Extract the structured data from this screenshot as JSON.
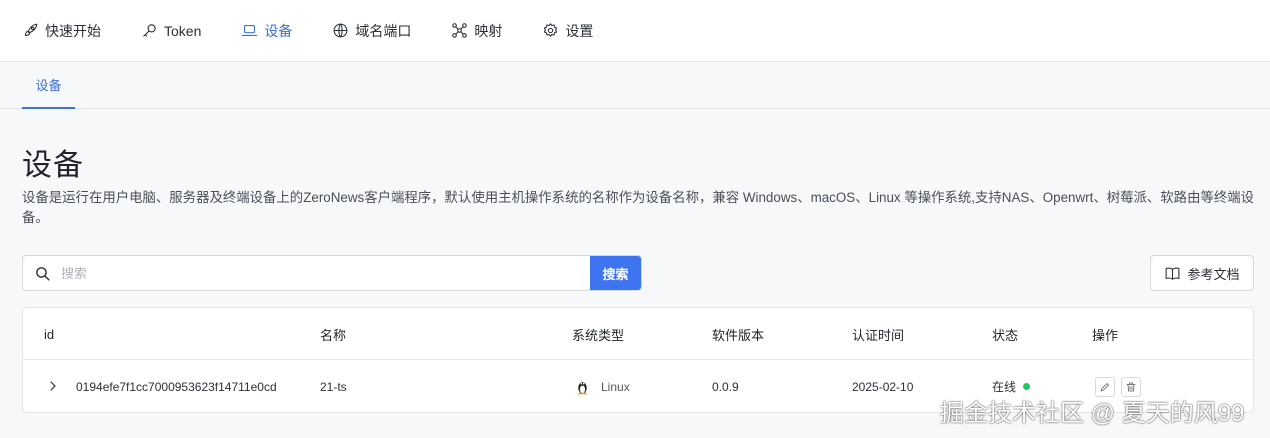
{
  "nav": {
    "items": [
      {
        "label": "快速开始",
        "icon": "rocket-icon"
      },
      {
        "label": "Token",
        "icon": "key-icon"
      },
      {
        "label": "设备",
        "icon": "laptop-icon",
        "active": true
      },
      {
        "label": "域名端口",
        "icon": "globe-icon"
      },
      {
        "label": "映射",
        "icon": "network-icon"
      },
      {
        "label": "设置",
        "icon": "gear-icon"
      }
    ]
  },
  "subtabs": {
    "active": "设备"
  },
  "page": {
    "title": "设备",
    "description": "设备是运行在用户电脑、服务器及终端设备上的ZeroNews客户端程序，默认使用主机操作系统的名称作为设备名称，兼容 Windows、macOS、Linux 等操作系统,支持NAS、Openwrt、树莓派、软路由等终端设备。"
  },
  "search": {
    "placeholder": "搜索",
    "value": "",
    "button_label": "搜索"
  },
  "docs_button": {
    "label": "参考文档",
    "icon": "book-icon"
  },
  "table": {
    "columns": [
      "id",
      "名称",
      "系统类型",
      "软件版本",
      "认证时间",
      "状态",
      "操作"
    ],
    "rows": [
      {
        "id": "0194efe7f1cc7000953623f14711e0cd",
        "name": "21-ts",
        "os": "Linux",
        "version": "0.0.9",
        "auth_time": "2025-02-10",
        "status": "在线"
      }
    ]
  },
  "colors": {
    "accent": "#3b71d8",
    "search_button": "#3f74f0",
    "online": "#22c55e"
  },
  "watermark": "掘金技术社区 @ 夏天的风99"
}
